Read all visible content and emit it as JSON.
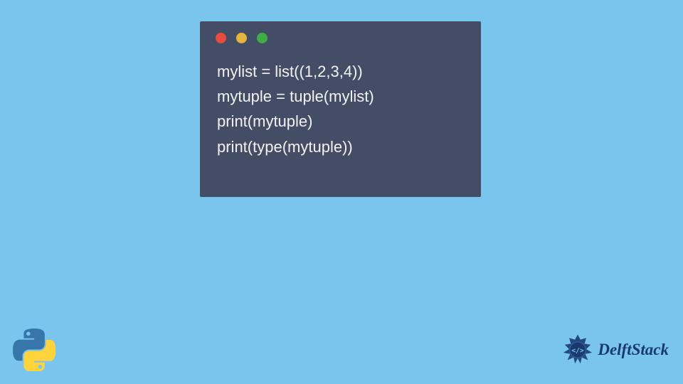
{
  "code": {
    "line1": "mylist = list((1,2,3,4))",
    "line2": "mytuple = tuple(mylist)",
    "line3": "print(mytuple)",
    "line4": "print(type(mytuple))"
  },
  "logo": {
    "brand": "DelftStack"
  },
  "colors": {
    "background": "#7ac5ed",
    "window": "#434d66",
    "dot_red": "#e94b3c",
    "dot_yellow": "#e7b43e",
    "dot_green": "#3fad47",
    "text": "#f2f2f2",
    "brand_blue": "#1a3a6e"
  }
}
